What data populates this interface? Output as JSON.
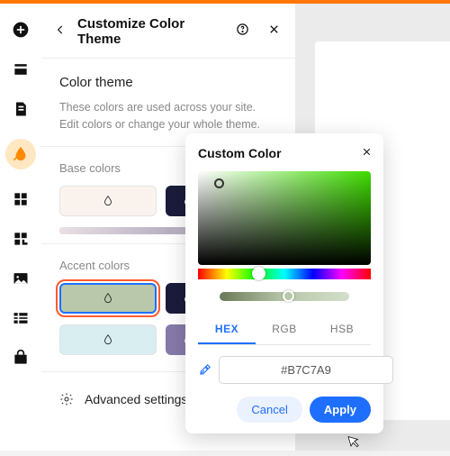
{
  "header": {
    "title": "Customize Color Theme"
  },
  "section": {
    "title": "Color theme",
    "description": "These colors are used across your site. Edit colors or change your whole theme."
  },
  "base": {
    "label": "Base colors"
  },
  "accent": {
    "label": "Accent colors"
  },
  "advanced": {
    "label": "Advanced settings"
  },
  "popup": {
    "title": "Custom Color",
    "tabs": {
      "hex": "HEX",
      "rgb": "RGB",
      "hsb": "HSB"
    },
    "value": "#B7C7A9",
    "cancel": "Cancel",
    "apply": "Apply"
  }
}
